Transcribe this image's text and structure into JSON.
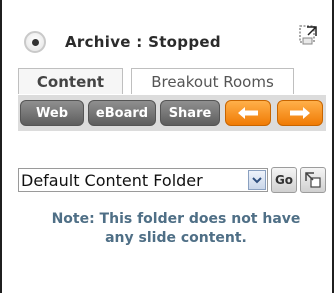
{
  "status": {
    "text": "Archive : Stopped"
  },
  "tabs": [
    {
      "label": "Content",
      "active": true
    },
    {
      "label": "Breakout Rooms",
      "active": false
    }
  ],
  "toolbar": {
    "web_label": "Web",
    "eboard_label": "eBoard",
    "share_label": "Share",
    "prev_icon": "arrow-left-icon",
    "next_icon": "arrow-right-icon"
  },
  "folder": {
    "selected": "Default Content Folder",
    "go_label": "Go",
    "upload_icon": "upload-icon"
  },
  "note": {
    "line1": "Note: This folder does not have",
    "line2": "any slide content."
  },
  "colors": {
    "gray_button": "#6f6f6f",
    "orange_button": "#f5900f",
    "note_text": "#4f6f86"
  }
}
